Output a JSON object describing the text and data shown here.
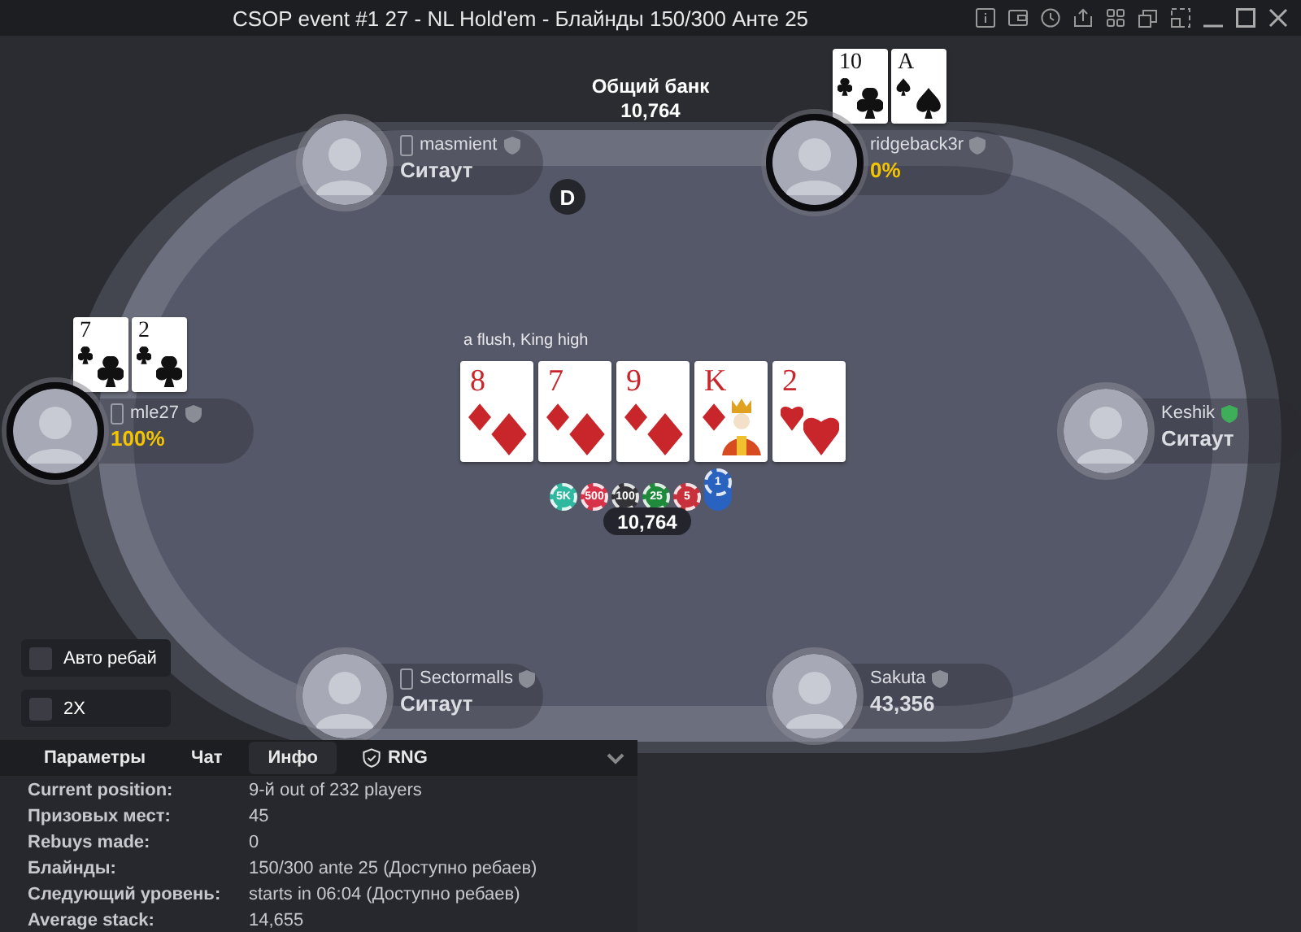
{
  "window": {
    "title": "CSOP event #1 27 - NL Hold'em - Блайнды 150/300 Анте 25"
  },
  "pot": {
    "label": "Общий банк",
    "amount": "10,764"
  },
  "dealer_button": "D",
  "players": [
    {
      "name": "masmient",
      "status": "Ситаут",
      "highlight": false,
      "mobile": true,
      "verified": false,
      "active": false
    },
    {
      "name": "ridgeback3r",
      "status": "0%",
      "highlight": true,
      "mobile": false,
      "verified": false,
      "active": true,
      "cards": [
        {
          "rank": "10",
          "kind": "clubs"
        },
        {
          "rank": "A",
          "kind": "spades"
        }
      ]
    },
    {
      "name": "mle27",
      "status": "100%",
      "highlight": true,
      "mobile": true,
      "verified": false,
      "active": true,
      "cards": [
        {
          "rank": "7",
          "kind": "clubs"
        },
        {
          "rank": "2",
          "kind": "clubs"
        }
      ]
    },
    {
      "name": "Keshik",
      "status": "Ситаут",
      "highlight": false,
      "mobile": false,
      "verified": true,
      "active": false
    },
    {
      "name": "Sectormalls",
      "status": "Ситаут",
      "highlight": false,
      "mobile": true,
      "verified": false,
      "active": false
    },
    {
      "name": "Sakuta",
      "status": "43,356",
      "highlight": false,
      "mobile": false,
      "verified": false,
      "active": false
    }
  ],
  "hand_description": "a flush, King high",
  "board": [
    {
      "rank": "8",
      "kind": "diamonds",
      "face": false
    },
    {
      "rank": "7",
      "kind": "diamonds",
      "face": false
    },
    {
      "rank": "9",
      "kind": "diamonds",
      "face": false
    },
    {
      "rank": "K",
      "kind": "diamonds",
      "face": true
    },
    {
      "rank": "2",
      "kind": "hearts",
      "face": false
    }
  ],
  "chips": [
    {
      "label": "5K",
      "color": "#2fb8a0"
    },
    {
      "label": "500",
      "color": "#d8324a"
    },
    {
      "label": "100",
      "color": "#333338"
    },
    {
      "label": "25",
      "color": "#1f8a3c"
    },
    {
      "label": "5",
      "color": "#c8303c"
    },
    {
      "label": "1",
      "color": "#2a62c0"
    }
  ],
  "center_pot": "10,764",
  "options": [
    {
      "label": "Авто ребай",
      "checked": false
    },
    {
      "label": "2X",
      "checked": false
    }
  ],
  "tabs": [
    {
      "label": "Параметры",
      "selected": false,
      "kind": "text"
    },
    {
      "label": "Чат",
      "selected": false,
      "kind": "text"
    },
    {
      "label": "Инфо",
      "selected": true,
      "kind": "text"
    },
    {
      "label": "RNG",
      "selected": false,
      "kind": "shield"
    }
  ],
  "info": [
    {
      "label": "Current position:",
      "value": "9-й out of 232 players"
    },
    {
      "label": "Призовых мест:",
      "value": "45"
    },
    {
      "label": "Rebuys made:",
      "value": "0"
    },
    {
      "label": "Блайнды:",
      "value": "150/300 ante 25 (Доступно ребаев)"
    },
    {
      "label": "Следующий уровень:",
      "value": "starts in 06:04 (Доступно ребаев)"
    },
    {
      "label": "Average stack:",
      "value": "14,655"
    }
  ]
}
